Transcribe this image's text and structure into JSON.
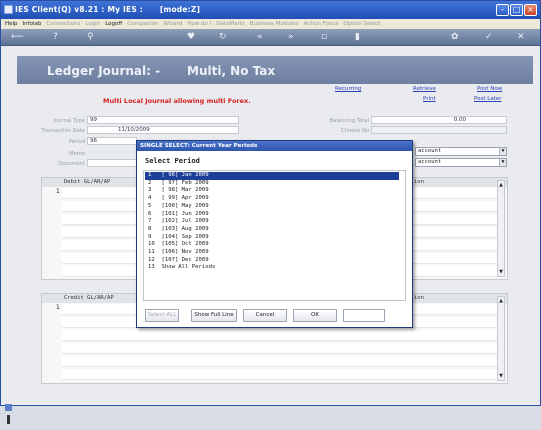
{
  "window": {
    "title": "IES Client(Q) v8.21 : My IES :",
    "mode": "[mode:Z]"
  },
  "menu": [
    {
      "label": "Help",
      "enabled": true
    },
    {
      "label": "Infolab",
      "enabled": true
    },
    {
      "label": "Connections",
      "enabled": false
    },
    {
      "label": "Login",
      "enabled": false
    },
    {
      "label": "Logoff",
      "enabled": true
    },
    {
      "label": "Companion",
      "enabled": false
    },
    {
      "label": "Wizard",
      "enabled": false
    },
    {
      "label": "How do I",
      "enabled": false
    },
    {
      "label": "DataMarts",
      "enabled": false
    },
    {
      "label": "Business Modules",
      "enabled": false
    },
    {
      "label": "Action Focus",
      "enabled": false
    },
    {
      "label": "Option Select",
      "enabled": false
    }
  ],
  "header": {
    "title": "Ledger Journal: -",
    "subtitle": "Multi, No Tax"
  },
  "links": {
    "recurring": "Recurring",
    "retrieve": "Retrieve",
    "print": "Print",
    "post_now": "Post Now",
    "post_later": "Post Later"
  },
  "warning": "Multi Local Journal allowing multi Forex.",
  "fields": {
    "journal_type_label": "Journal Type",
    "journal_type": "99",
    "transaction_date_label": "Transaction Date",
    "transaction_date": "11/10/2009",
    "period_label": "Period",
    "period": "96",
    "memo_label": "Memo",
    "document_label": "Document",
    "balancing_total_label": "Balancing Total",
    "balancing_total": "0.00",
    "choose_label": "Choose No"
  },
  "combos": {
    "debit_account": "account",
    "credit_account": "account"
  },
  "debit_panel": {
    "header": "Debit GL/AR/AP",
    "right_header": "ion",
    "first_row": "1"
  },
  "credit_panel": {
    "header": "Credit GL/AR/AP",
    "right_header": "ion",
    "first_row": "1"
  },
  "dialog": {
    "title": "SINGLE SELECT: Current Year Periods",
    "subtitle": "Select Period",
    "selected_index": 0,
    "items": [
      "1   [ 96] Jan 2009",
      "2   [ 97] Feb 2009",
      "3   [ 98] Mar 2009",
      "4   [ 99] Apr 2009",
      "5   [100] May 2009",
      "6   [101] Jun 2009",
      "7   [102] Jul 2009",
      "8   [103] Aug 2009",
      "9   [104] Sep 2009",
      "10  [105] Oct 2009",
      "11  [106] Nov 2009",
      "12  [107] Dec 2009",
      "13  Show All Periods"
    ],
    "buttons": {
      "select_all": "Select ALL",
      "show_full_line": "Show Full Line",
      "cancel": "Cancel",
      "ok": "OK"
    }
  }
}
